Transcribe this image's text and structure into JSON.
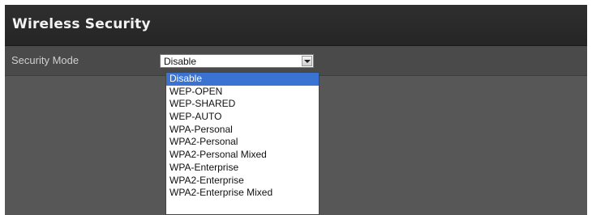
{
  "section": {
    "title": "Wireless Security"
  },
  "security_mode": {
    "label": "Security Mode",
    "selected_value": "Disable",
    "options": [
      "Disable",
      "WEP-OPEN",
      "WEP-SHARED",
      "WEP-AUTO",
      "WPA-Personal",
      "WPA2-Personal",
      "WPA2-Personal Mixed",
      "WPA-Enterprise",
      "WPA2-Enterprise",
      "WPA2-Enterprise Mixed"
    ],
    "highlighted_index": 0
  },
  "colors": {
    "header_bg": "#2a2a2a",
    "panel_bg": "#555555",
    "selection": "#3a73d1"
  }
}
